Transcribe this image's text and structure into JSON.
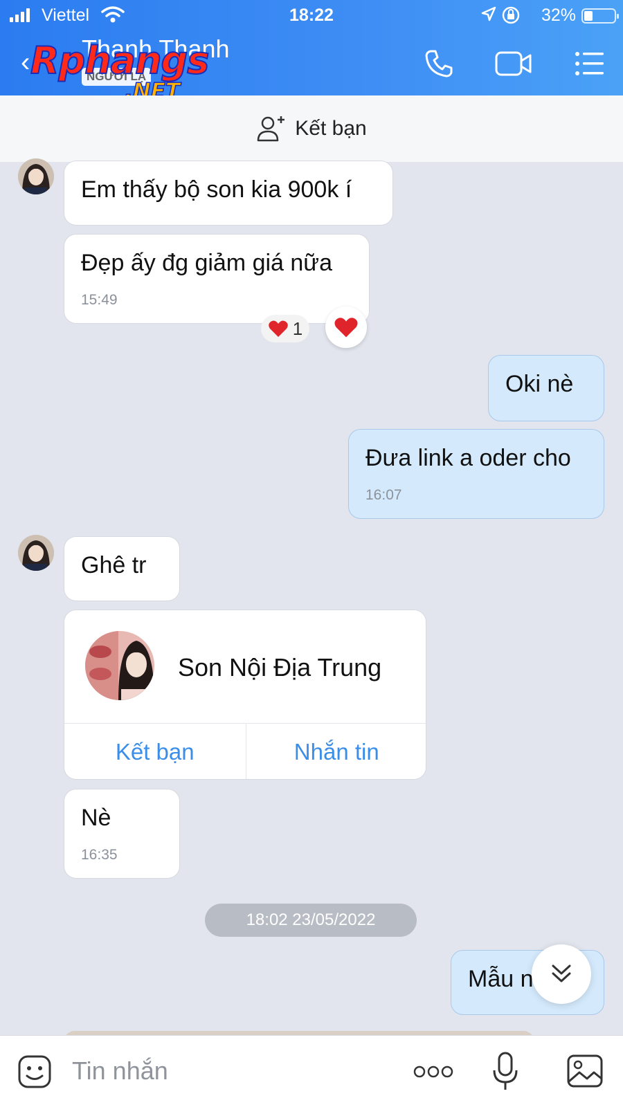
{
  "status": {
    "carrier": "Viettel",
    "time": "18:22",
    "battery": "32%"
  },
  "header": {
    "name": "Thanh Thanh",
    "badge": "NGƯỜI LẠ",
    "logo_main": "Rphangs",
    "logo_sub": ".NET"
  },
  "add_friend": {
    "label": "Kết bạn"
  },
  "messages": {
    "m1": "Em thấy bộ son kia 900k í",
    "m2": "Đẹp ấy đg giảm giá nữa",
    "m2_time": "15:49",
    "reaction_count": "1",
    "m3": "Oki nè",
    "m4": "Đưa link a oder cho",
    "m4_time": "16:07",
    "m5": "Ghê tr",
    "card_name": "Son Nội Địa Trung",
    "card_add": "Kết bạn",
    "card_msg": "Nhắn tin",
    "m6": "Nè",
    "m6_time": "16:35",
    "date_sep": "18:02 23/05/2022",
    "m7": "Mẫu n"
  },
  "input": {
    "placeholder": "Tin nhắn"
  },
  "colors": {
    "header": "#3f8ef5",
    "outgoing": "#d4eafc",
    "link": "#3b8ee8",
    "background": "#e2e5ed"
  },
  "icons": [
    "signal-icon",
    "wifi-icon",
    "location-icon",
    "rotation-lock-icon",
    "battery-icon",
    "back-icon",
    "phone-icon",
    "video-icon",
    "menu-icon",
    "add-friend-icon",
    "heart-icon",
    "chevron-down-icon",
    "sticker-icon",
    "more-icon",
    "mic-icon",
    "image-icon"
  ]
}
